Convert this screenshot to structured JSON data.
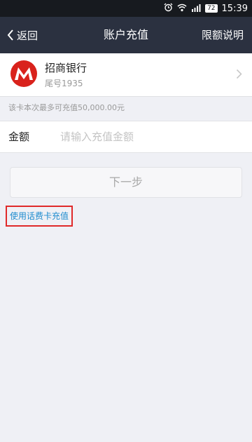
{
  "status_bar": {
    "alarm_icon": "alarm-clock-icon",
    "wifi_icon": "wifi-icon",
    "signal_icon": "signal-bars-icon",
    "battery": "72",
    "time": "15:39"
  },
  "nav": {
    "back_label": "返回",
    "title": "账户充值",
    "right_label": "限额说明"
  },
  "bank": {
    "name": "招商银行",
    "tail": "尾号1935",
    "logo_icon": "cmb-bank-logo-icon",
    "brand_color": "#d9221c"
  },
  "limit_note": "该卡本次最多可充值50,000.00元",
  "amount": {
    "label": "金额",
    "placeholder": "请输入充值金额",
    "value": ""
  },
  "next_button": "下一步",
  "phone_card_link": "使用话费卡充值",
  "colors": {
    "nav_bg": "#2b3140",
    "status_bg": "#171a1f",
    "page_bg": "#eff0f5",
    "link": "#1f8ccf",
    "highlight_box": "#e02a2a"
  }
}
